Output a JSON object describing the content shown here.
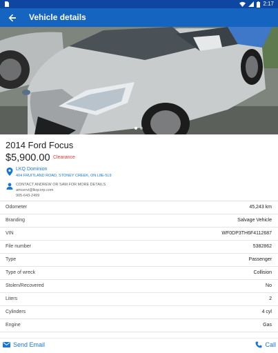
{
  "status_bar": {
    "time": "2:17"
  },
  "app_bar": {
    "title": "Vehicle details"
  },
  "vehicle": {
    "title": "2014 Ford Focus",
    "price": "$5,900.00",
    "badge": "Clearance"
  },
  "location": {
    "name": "LKQ Dominion",
    "address": "404 FRUITLAND ROAD, STONEY CREEK, ON L8E-5L9"
  },
  "contact": {
    "note": "CONTACT ANDREW OR SAM FOR MORE DETAILS",
    "email": "amcervi@lkqcorp.com",
    "phone": "905-643-2499"
  },
  "specs": [
    {
      "label": "Odometer",
      "value": "45,243 km"
    },
    {
      "label": "Branding",
      "value": "Salvage Vehicle"
    },
    {
      "label": "VIN",
      "value": "WF0DP3TH6F4112687"
    },
    {
      "label": "File number",
      "value": "5382862"
    },
    {
      "label": "Type",
      "value": "Passenger"
    },
    {
      "label": "Type of wreck",
      "value": "Collision"
    },
    {
      "label": "Stolen/Recovered",
      "value": "No"
    },
    {
      "label": "Liters",
      "value": "2"
    },
    {
      "label": "Cylinders",
      "value": "4 cyl"
    },
    {
      "label": "Engine",
      "value": "Gas"
    }
  ],
  "actions": {
    "email": "Send Email",
    "call": "Call"
  },
  "icons": [
    "back-arrow-icon",
    "location-pin-icon",
    "person-icon",
    "email-icon",
    "phone-icon",
    "wifi-icon",
    "battery-icon"
  ],
  "colors": {
    "status_bar": "#0d47a1",
    "app_bar": "#1565c0",
    "link": "#1976d2",
    "clearance": "#e53935"
  }
}
